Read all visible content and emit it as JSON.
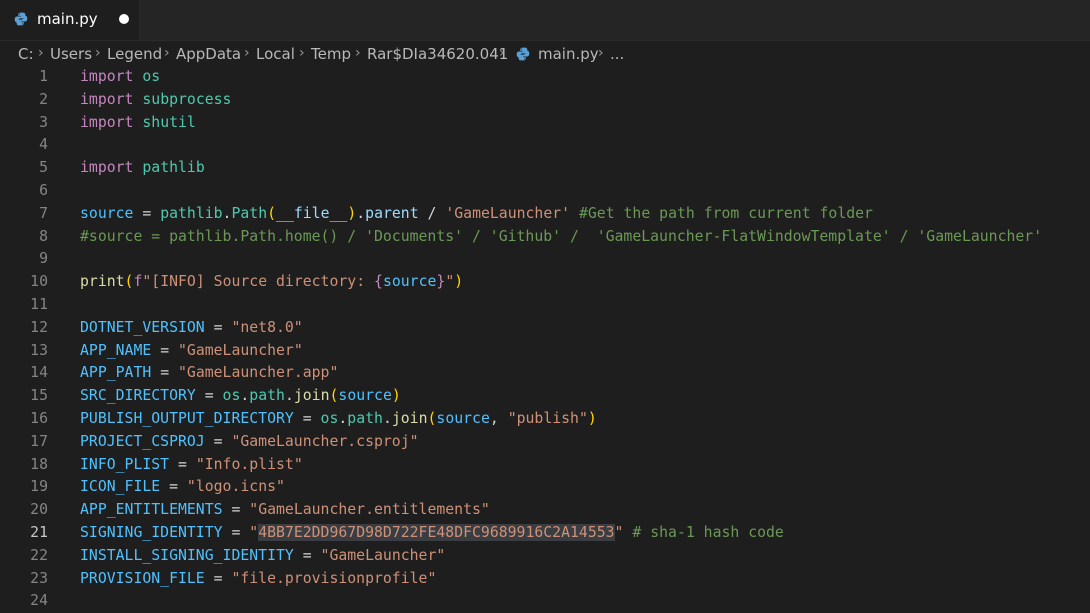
{
  "tab": {
    "filename": "main.py",
    "icon": "python-icon",
    "unsaved": true
  },
  "breadcrumb": {
    "segments": [
      "C:",
      "Users",
      "Legend",
      "AppData",
      "Local",
      "Temp",
      "Rar$DIa34620.041"
    ],
    "file": "main.py",
    "ellipsis": "..."
  },
  "editor": {
    "language": "python",
    "active_line": 21,
    "selection": "4BB7E2DD967D98D722FE48DFC9689916C2A14553",
    "lines": [
      {
        "n": "1",
        "t": [
          {
            "c": "kw",
            "v": "import"
          },
          {
            "c": "op",
            "v": " "
          },
          {
            "c": "mod",
            "v": "os"
          }
        ]
      },
      {
        "n": "2",
        "t": [
          {
            "c": "kw",
            "v": "import"
          },
          {
            "c": "op",
            "v": " "
          },
          {
            "c": "mod",
            "v": "subprocess"
          }
        ]
      },
      {
        "n": "3",
        "t": [
          {
            "c": "kw",
            "v": "import"
          },
          {
            "c": "op",
            "v": " "
          },
          {
            "c": "mod",
            "v": "shutil"
          }
        ]
      },
      {
        "n": "4",
        "t": []
      },
      {
        "n": "5",
        "t": [
          {
            "c": "kw",
            "v": "import"
          },
          {
            "c": "op",
            "v": " "
          },
          {
            "c": "mod",
            "v": "pathlib"
          }
        ]
      },
      {
        "n": "6",
        "t": []
      },
      {
        "n": "7",
        "t": [
          {
            "c": "var",
            "v": "source"
          },
          {
            "c": "op",
            "v": " = "
          },
          {
            "c": "mod",
            "v": "pathlib"
          },
          {
            "c": "op",
            "v": "."
          },
          {
            "c": "mod",
            "v": "Path"
          },
          {
            "c": "b1",
            "v": "("
          },
          {
            "c": "prop",
            "v": "__file__"
          },
          {
            "c": "b1",
            "v": ")"
          },
          {
            "c": "op",
            "v": "."
          },
          {
            "c": "prop",
            "v": "parent"
          },
          {
            "c": "op",
            "v": " / "
          },
          {
            "c": "str",
            "v": "'GameLauncher'"
          },
          {
            "c": "op",
            "v": " "
          },
          {
            "c": "cmt",
            "v": "#Get the path from current folder"
          }
        ]
      },
      {
        "n": "8",
        "t": [
          {
            "c": "cmt",
            "v": "#source = pathlib.Path.home() / 'Documents' / 'Github' /  'GameLauncher-FlatWindowTemplate' / 'GameLauncher'"
          }
        ]
      },
      {
        "n": "9",
        "t": []
      },
      {
        "n": "10",
        "t": [
          {
            "c": "fn",
            "v": "print"
          },
          {
            "c": "b1",
            "v": "("
          },
          {
            "c": "kw",
            "v": "f"
          },
          {
            "c": "str",
            "v": "\"[INFO] Source directory: "
          },
          {
            "c": "kw",
            "v": "{"
          },
          {
            "c": "var",
            "v": "source"
          },
          {
            "c": "kw",
            "v": "}"
          },
          {
            "c": "str",
            "v": "\""
          },
          {
            "c": "b1",
            "v": ")"
          }
        ]
      },
      {
        "n": "11",
        "t": []
      },
      {
        "n": "12",
        "t": [
          {
            "c": "var",
            "v": "DOTNET_VERSION"
          },
          {
            "c": "op",
            "v": " = "
          },
          {
            "c": "str",
            "v": "\"net8.0\""
          }
        ]
      },
      {
        "n": "13",
        "t": [
          {
            "c": "var",
            "v": "APP_NAME"
          },
          {
            "c": "op",
            "v": " = "
          },
          {
            "c": "str",
            "v": "\"GameLauncher\""
          }
        ]
      },
      {
        "n": "14",
        "t": [
          {
            "c": "var",
            "v": "APP_PATH"
          },
          {
            "c": "op",
            "v": " = "
          },
          {
            "c": "str",
            "v": "\"GameLauncher.app\""
          }
        ]
      },
      {
        "n": "15",
        "t": [
          {
            "c": "var",
            "v": "SRC_DIRECTORY"
          },
          {
            "c": "op",
            "v": " = "
          },
          {
            "c": "mod",
            "v": "os"
          },
          {
            "c": "op",
            "v": "."
          },
          {
            "c": "mod",
            "v": "path"
          },
          {
            "c": "op",
            "v": "."
          },
          {
            "c": "fn",
            "v": "join"
          },
          {
            "c": "b1",
            "v": "("
          },
          {
            "c": "var",
            "v": "source"
          },
          {
            "c": "b1",
            "v": ")"
          }
        ]
      },
      {
        "n": "16",
        "t": [
          {
            "c": "var",
            "v": "PUBLISH_OUTPUT_DIRECTORY"
          },
          {
            "c": "op",
            "v": " = "
          },
          {
            "c": "mod",
            "v": "os"
          },
          {
            "c": "op",
            "v": "."
          },
          {
            "c": "mod",
            "v": "path"
          },
          {
            "c": "op",
            "v": "."
          },
          {
            "c": "fn",
            "v": "join"
          },
          {
            "c": "b1",
            "v": "("
          },
          {
            "c": "var",
            "v": "source"
          },
          {
            "c": "op",
            "v": ", "
          },
          {
            "c": "str",
            "v": "\"publish\""
          },
          {
            "c": "b1",
            "v": ")"
          }
        ]
      },
      {
        "n": "17",
        "t": [
          {
            "c": "var",
            "v": "PROJECT_CSPROJ"
          },
          {
            "c": "op",
            "v": " = "
          },
          {
            "c": "str",
            "v": "\"GameLauncher.csproj\""
          }
        ]
      },
      {
        "n": "18",
        "t": [
          {
            "c": "var",
            "v": "INFO_PLIST"
          },
          {
            "c": "op",
            "v": " = "
          },
          {
            "c": "str",
            "v": "\"Info.plist\""
          }
        ]
      },
      {
        "n": "19",
        "t": [
          {
            "c": "var",
            "v": "ICON_FILE"
          },
          {
            "c": "op",
            "v": " = "
          },
          {
            "c": "str",
            "v": "\"logo.icns\""
          }
        ]
      },
      {
        "n": "20",
        "t": [
          {
            "c": "var",
            "v": "APP_ENTITLEMENTS"
          },
          {
            "c": "op",
            "v": " = "
          },
          {
            "c": "str",
            "v": "\"GameLauncher.entitlements\""
          }
        ]
      },
      {
        "n": "21",
        "t": [
          {
            "c": "var",
            "v": "SIGNING_IDENTITY"
          },
          {
            "c": "op",
            "v": " = "
          },
          {
            "c": "str",
            "v": "\""
          },
          {
            "c": "str sel",
            "v": "4BB7E2DD967D98D722FE48DFC9689916C2A14553"
          },
          {
            "c": "str",
            "v": "\""
          },
          {
            "c": "op",
            "v": " "
          },
          {
            "c": "cmt",
            "v": "# sha-1 hash code"
          }
        ]
      },
      {
        "n": "22",
        "t": [
          {
            "c": "var",
            "v": "INSTALL_SIGNING_IDENTITY"
          },
          {
            "c": "op",
            "v": " = "
          },
          {
            "c": "str",
            "v": "\"GameLauncher\""
          }
        ]
      },
      {
        "n": "23",
        "t": [
          {
            "c": "var",
            "v": "PROVISION_FILE"
          },
          {
            "c": "op",
            "v": " = "
          },
          {
            "c": "str",
            "v": "\"file.provisionprofile\""
          }
        ]
      },
      {
        "n": "24",
        "t": []
      }
    ]
  }
}
